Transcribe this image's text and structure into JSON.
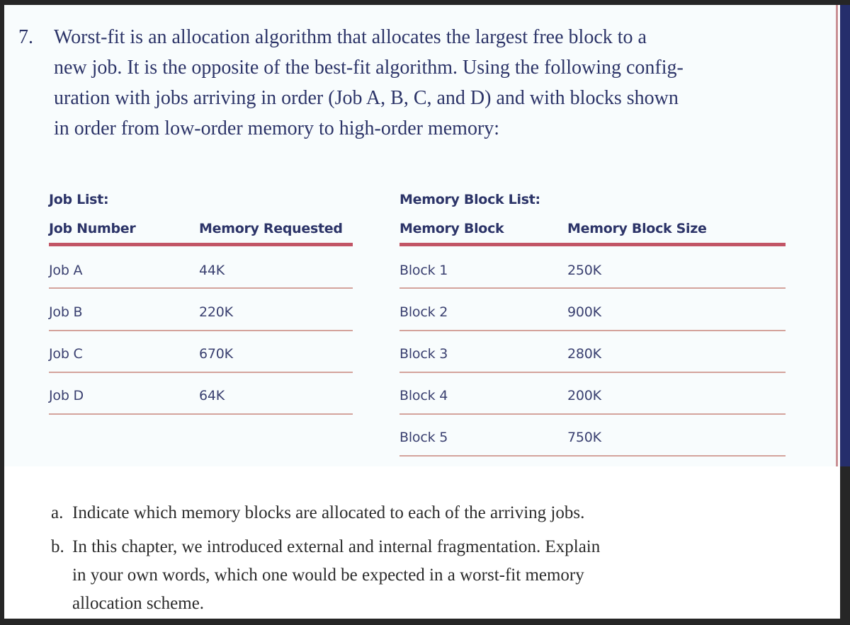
{
  "question": {
    "number": "7.",
    "lines": [
      "Worst-fit is an allocation algorithm that allocates the largest free block to a",
      "new job. It is the opposite of the best-fit algorithm. Using the following config-",
      "uration with jobs arriving in order (Job A, B, C, and D) and with blocks shown",
      "in order from low-order memory to high-order memory:"
    ]
  },
  "job_table": {
    "title": "Job List:",
    "headers": [
      "Job Number",
      "Memory Requested"
    ],
    "rows": [
      [
        "Job A",
        "44K"
      ],
      [
        "Job B",
        "220K"
      ],
      [
        "Job C",
        "670K"
      ],
      [
        "Job D",
        "64K"
      ]
    ]
  },
  "block_table": {
    "title": "Memory Block List:",
    "headers": [
      "Memory Block",
      "Memory Block Size"
    ],
    "rows": [
      [
        "Block 1",
        "250K"
      ],
      [
        "Block 2",
        "900K"
      ],
      [
        "Block 3",
        "280K"
      ],
      [
        "Block 4",
        "200K"
      ],
      [
        "Block 5",
        "750K"
      ]
    ]
  },
  "subquestions": [
    {
      "label": "a.",
      "lines": [
        "Indicate which memory blocks are allocated to each of the arriving jobs."
      ]
    },
    {
      "label": "b.",
      "lines": [
        "In this chapter, we introduced external and internal fragmentation. Explain",
        "in your own words, which one would be expected in a worst-fit memory",
        "allocation scheme."
      ]
    }
  ],
  "colors": {
    "text_navy": "#2c3468",
    "header_rule": "#c25566",
    "row_rule": "#d4a39c",
    "side_stripe": "#252e6c",
    "frame": "#262626"
  }
}
